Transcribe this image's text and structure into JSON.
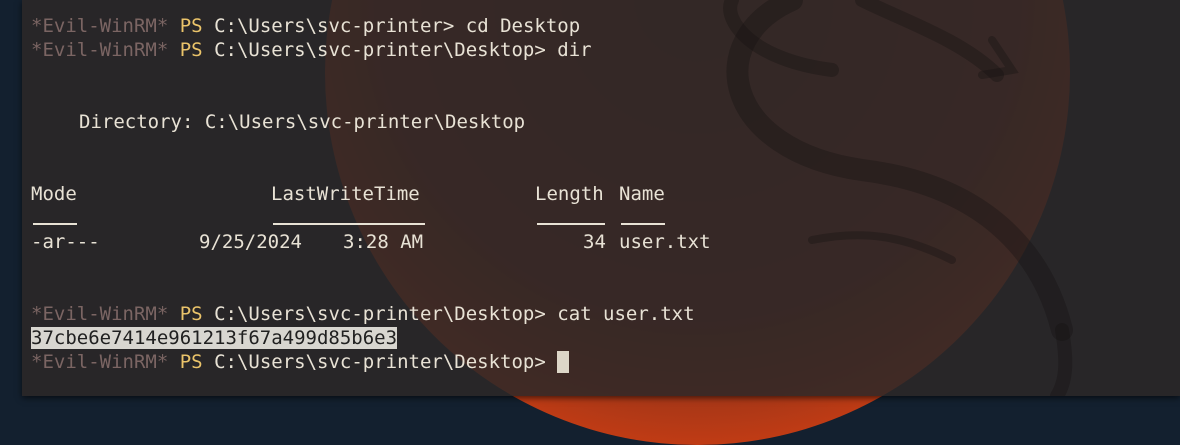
{
  "terminal": {
    "prompt_prefix": "*Evil-WinRM*",
    "prompt_ps": "PS",
    "lines": [
      {
        "path": "C:\\Users\\svc-printer>",
        "command": "cd Desktop"
      },
      {
        "path": "C:\\Users\\svc-printer\\Desktop>",
        "command": "dir"
      },
      {
        "path": "C:\\Users\\svc-printer\\Desktop>",
        "command": "cat user.txt"
      },
      {
        "path": "C:\\Users\\svc-printer\\Desktop>",
        "command": ""
      }
    ],
    "directory_line": "Directory: C:\\Users\\svc-printer\\Desktop",
    "table": {
      "headers": {
        "mode": "Mode",
        "lastwrite": "LastWriteTime",
        "length": "Length",
        "name": "Name"
      },
      "rows": [
        {
          "mode": "-ar---",
          "date": "9/25/2024",
          "time": "3:28 AM",
          "length": "34",
          "name": "user.txt"
        }
      ]
    },
    "file_output": "37cbe6e7414e961213f67a499d85b6e3"
  },
  "colors": {
    "terminal_bg": "#2c2828",
    "prompt_prefix": "#7b6563",
    "prompt_ps": "#ebc46a",
    "text": "#e8e2d5",
    "desktop_bg": "#13202f",
    "wallpaper_accent": "#f07020"
  }
}
